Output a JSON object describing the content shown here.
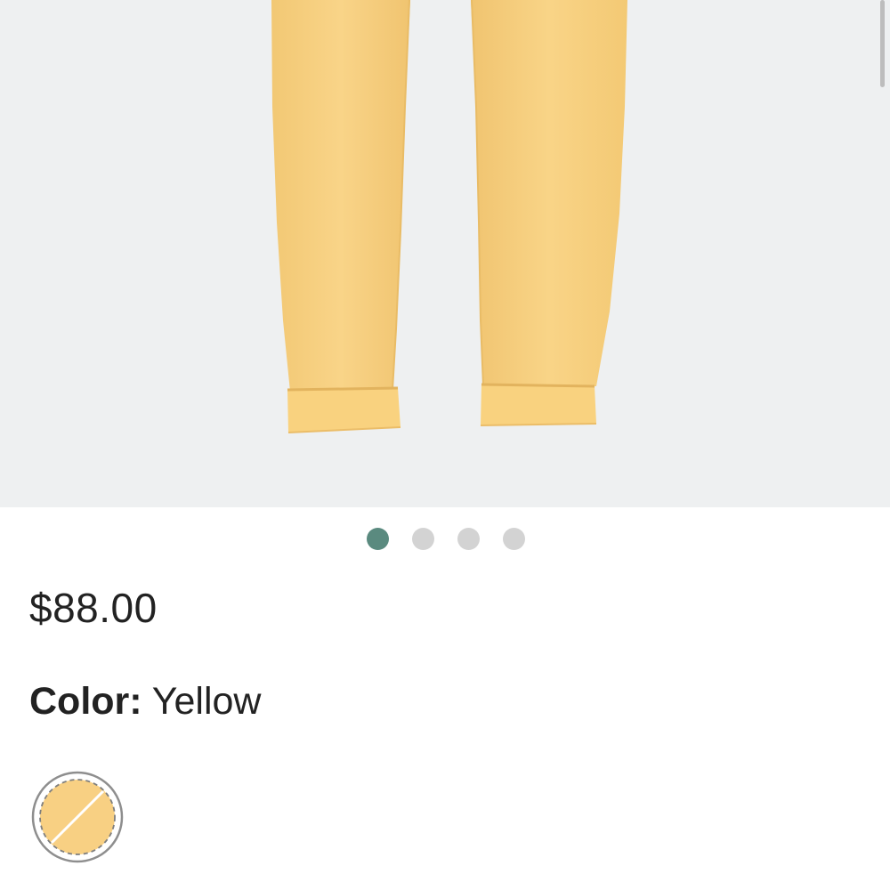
{
  "product": {
    "price": "$88.00",
    "color_label": "Color:",
    "color_value": "Yellow",
    "image_alt": "Yellow cuffed jeans"
  },
  "carousel": {
    "dot_count": 4,
    "active_index": 0
  },
  "swatches": [
    {
      "name": "Yellow",
      "color": "#f8d083",
      "selected": true,
      "unavailable": true
    }
  ],
  "colors": {
    "accent": "#5a8a7f",
    "inactive_dot": "#d3d3d3",
    "image_background": "#eef0f1",
    "garment": "#f8d07d",
    "text": "#222222"
  }
}
